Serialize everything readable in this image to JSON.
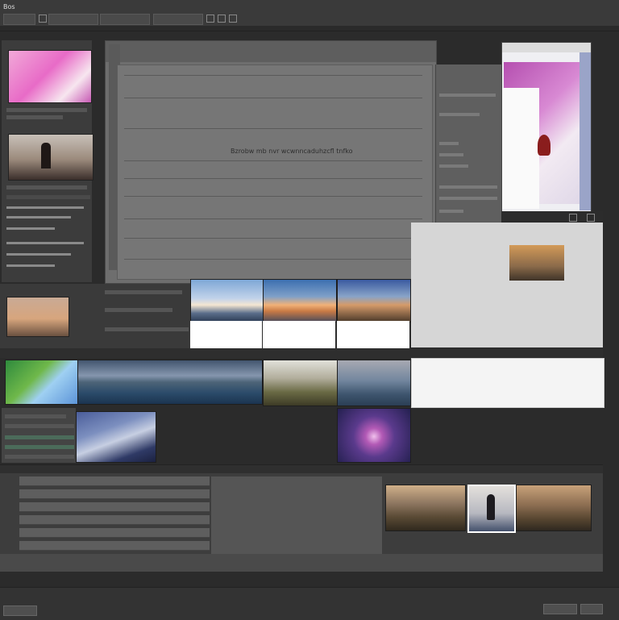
{
  "app": {
    "title": "Bos"
  },
  "dialog": {
    "lines": [
      "Bzrobw mb nvr wcwnncaduhzcfl tnfko"
    ]
  },
  "colors": {
    "background": "#2b2b2b",
    "panel": "#3c3c3c",
    "dialog": "#767676",
    "accent_magenta": "#c45ab8"
  },
  "icons": [
    "window-menu-icon",
    "minimize-icon",
    "maximize-icon",
    "close-icon",
    "play-icon",
    "settings-icon"
  ]
}
